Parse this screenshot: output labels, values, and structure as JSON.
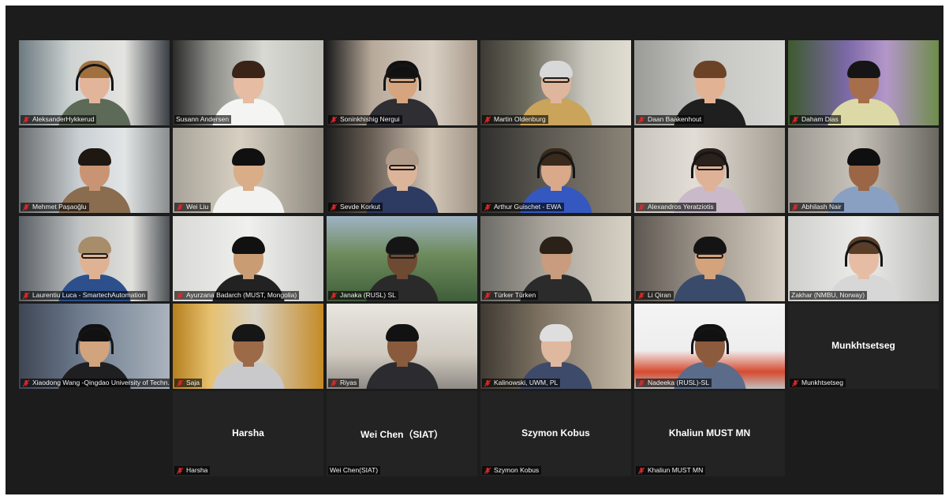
{
  "colors": {
    "gallery_bg": "#1c1c1c",
    "tile_bg": "#262626",
    "speaker_border": "#c9d64a",
    "muted_mic": "#e02828"
  },
  "participants": [
    {
      "name": "AleksanderHykkerud",
      "muted": true
    },
    {
      "name": "Susann Andersen",
      "muted": false,
      "active_speaker": true
    },
    {
      "name": "Soninkhishig Nergui",
      "muted": true
    },
    {
      "name": "Martin Oldenburg",
      "muted": true
    },
    {
      "name": "Daan Baakenhout",
      "muted": true
    },
    {
      "name": "Daham Dias",
      "muted": true
    },
    {
      "name": "Mehmet Paşaoğlu",
      "muted": true
    },
    {
      "name": "Wei Liu",
      "muted": true
    },
    {
      "name": "Sevde Korkut",
      "muted": true
    },
    {
      "name": "Arthur Guischet - EWA",
      "muted": true
    },
    {
      "name": "Alexandros Yeratziotis",
      "muted": true
    },
    {
      "name": "Abhilash Nair",
      "muted": true
    },
    {
      "name": "Laurentiu Luca - SmartechAutomation",
      "muted": true
    },
    {
      "name": "Ayurzana Badarch (MUST, Mongolia)",
      "muted": true
    },
    {
      "name": "Janaka (RUSL) SL",
      "muted": true
    },
    {
      "name": "Türker Türken",
      "muted": true
    },
    {
      "name": "Li Qiran",
      "muted": true
    },
    {
      "name": "Zakhar (NMBU, Norway)",
      "muted": false
    },
    {
      "name": "Xiaodong Wang -Qingdao University of Techn...",
      "muted": true
    },
    {
      "name": "Saja",
      "muted": true
    },
    {
      "name": "Riyas",
      "muted": true
    },
    {
      "name": "Kalinowski, UWM, PL",
      "muted": true
    },
    {
      "name": "Nadeeka (RUSL)-SL",
      "muted": true
    },
    {
      "name": "Munkhtsetseg",
      "display_name": "Munkhtsetseg",
      "muted": true,
      "video_off": true
    },
    {
      "name": "Harsha",
      "display_name": "Harsha",
      "muted": true,
      "video_off": true
    },
    {
      "name": "Wei Chen(SIAT)",
      "display_name": "Wei  Chen（SIAT）",
      "muted": false,
      "video_off": true
    },
    {
      "name": "Szymon Kobus",
      "display_name": "Szymon Kobus",
      "muted": true,
      "video_off": true
    },
    {
      "name": "Khaliun MUST MN",
      "display_name": "Khaliun MUST MN",
      "muted": true,
      "video_off": true
    }
  ]
}
